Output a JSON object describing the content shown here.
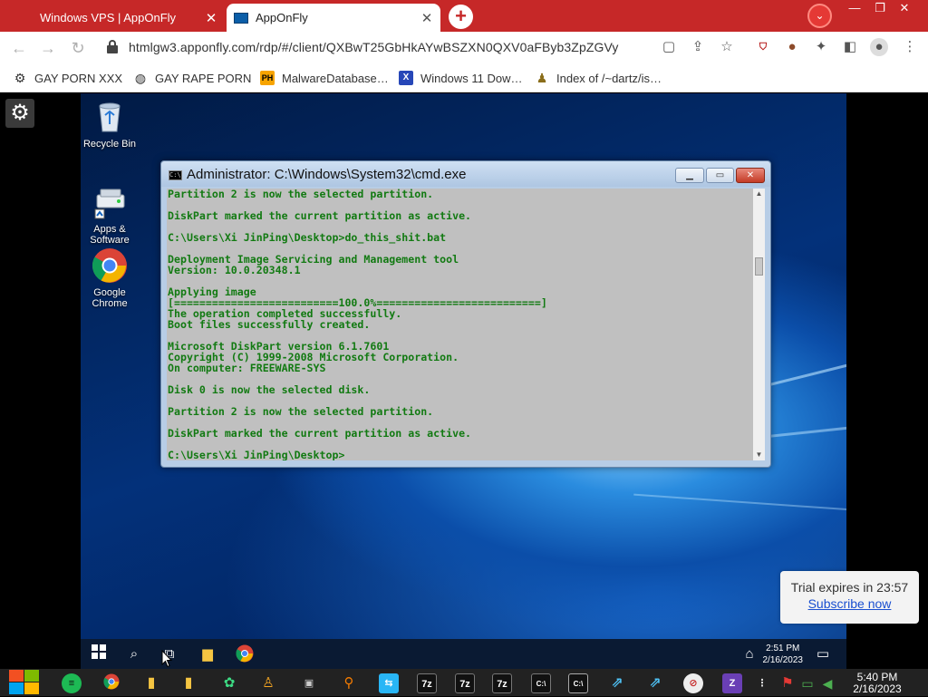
{
  "browser": {
    "tabs": [
      {
        "label": "Windows VPS | AppOnFly",
        "active": false
      },
      {
        "label": "AppOnFly",
        "active": true
      }
    ],
    "new_tab_symbol": "+",
    "url": "htmlgw3.apponfly.com/rdp/#/client/QXBwT25GbHkAYwBSZXN0QXV0aFByb3ZpZGVy",
    "bookmarks": [
      {
        "label": "GAY PORN XXX",
        "icon": "globe-icon"
      },
      {
        "label": "GAY RAPE PORN",
        "icon": "globe-icon"
      },
      {
        "label": "MalwareDatabase…",
        "icon": "ph-icon"
      },
      {
        "label": "Windows 11 Dow…",
        "icon": "x-icon"
      },
      {
        "label": "Index of /~dartz/is…",
        "icon": "person-icon"
      }
    ]
  },
  "desktop": {
    "icons": [
      {
        "label": "Recycle Bin"
      },
      {
        "label": "Apps & Software"
      },
      {
        "label": "Google Chrome"
      }
    ],
    "taskbar": {
      "time": "2:51 PM",
      "date": "2/16/2023"
    }
  },
  "cmd": {
    "title": "Administrator: C:\\Windows\\System32\\cmd.exe",
    "lines": [
      "Partition 2 is now the selected partition.",
      "",
      "DiskPart marked the current partition as active.",
      "",
      "C:\\Users\\Xi JinPing\\Desktop>do_this_shit.bat",
      "",
      "Deployment Image Servicing and Management tool",
      "Version: 10.0.20348.1",
      "",
      "Applying image",
      "[==========================100.0%==========================]",
      "The operation completed successfully.",
      "Boot files successfully created.",
      "",
      "Microsoft DiskPart version 6.1.7601",
      "Copyright (C) 1999-2008 Microsoft Corporation.",
      "On computer: FREEWARE-SYS",
      "",
      "Disk 0 is now the selected disk.",
      "",
      "Partition 2 is now the selected partition.",
      "",
      "DiskPart marked the current partition as active.",
      "",
      "C:\\Users\\Xi JinPing\\Desktop>"
    ]
  },
  "trial": {
    "text": "Trial expires in 23:57",
    "link": "Subscribe now"
  },
  "host_taskbar": {
    "time": "5:40 PM",
    "date": "2/16/2023",
    "zip_label": "7z",
    "z_label": "Z"
  }
}
